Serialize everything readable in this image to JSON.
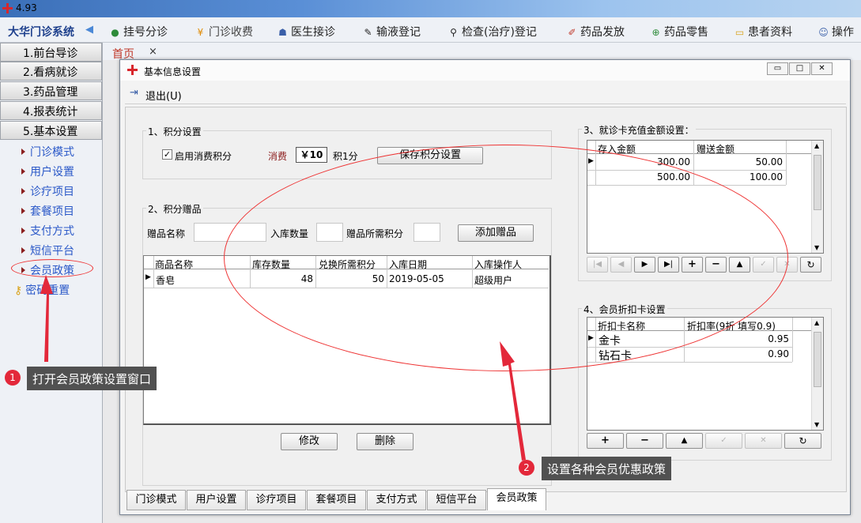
{
  "window": {
    "title": "4.93"
  },
  "app": {
    "name": "大华门诊系统"
  },
  "toolbar": {
    "items": [
      "挂号分诊",
      "门诊收费",
      "医生接诊",
      "输液登记",
      "检查(治疗)登记",
      "药品发放",
      "药品零售",
      "患者资料",
      "操作"
    ]
  },
  "sidebar": {
    "headers": [
      "1.前台导诊",
      "2.看病就诊",
      "3.药品管理",
      "4.报表统计",
      "5.基本设置"
    ],
    "items": [
      "门诊模式",
      "用户设置",
      "诊疗项目",
      "套餐项目",
      "支付方式",
      "短信平台",
      "会员政策",
      "密码重置"
    ]
  },
  "tabs": {
    "home": "首页",
    "close": "×"
  },
  "dialog": {
    "title": "基本信息设置",
    "exit_label": "退出(U)",
    "points": {
      "title": "1、积分设置",
      "checkbox_label": "启用消费积分",
      "checked": true,
      "consume_label": "消费",
      "amount": "￥10",
      "per_point": "积1分",
      "save_button": "保存积分设置"
    },
    "gifts": {
      "title": "2、积分赠品",
      "name_label": "赠品名称",
      "qty_label": "入库数量",
      "points_label": "赠品所需积分",
      "add_button": "添加赠品",
      "columns": [
        "商品名称",
        "库存数量",
        "兑换所需积分",
        "入库日期",
        "入库操作人"
      ],
      "rows": [
        [
          "香皂",
          "48",
          "50",
          "2019-05-05",
          "超级用户"
        ]
      ],
      "edit_button": "修改",
      "delete_button": "删除"
    },
    "recharge": {
      "title": "3、就诊卡充值金额设置：",
      "columns": [
        "存入金额",
        "赠送金额"
      ],
      "rows": [
        [
          "300.00",
          "50.00"
        ],
        [
          "500.00",
          "100.00"
        ]
      ]
    },
    "discount": {
      "title": "4、会员折扣卡设置",
      "columns": [
        "折扣卡名称",
        "折扣率(9折 填写0.9)"
      ],
      "rows": [
        [
          "金卡",
          "0.95"
        ],
        [
          "钻石卡",
          "0.90"
        ]
      ]
    },
    "bottom_tabs": [
      "门诊模式",
      "用户设置",
      "诊疗项目",
      "套餐项目",
      "支付方式",
      "短信平台",
      "会员政策"
    ],
    "selected_tab": "会员政策"
  },
  "annotations": {
    "one": {
      "num": "1",
      "text": "打开会员政策设置窗口"
    },
    "two": {
      "num": "2",
      "text": "设置各种会员优惠政策"
    }
  }
}
